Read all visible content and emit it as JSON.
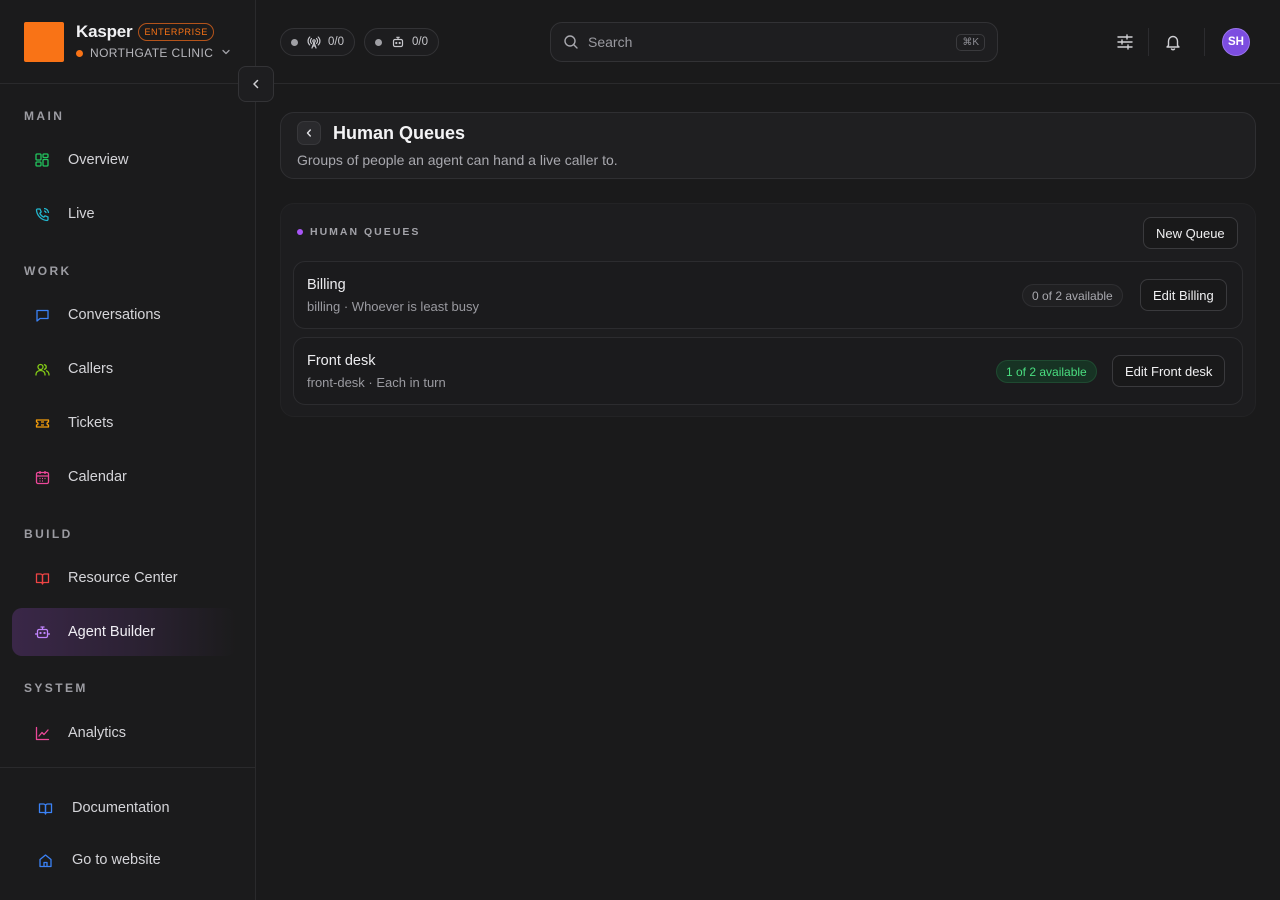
{
  "brand": {
    "name": "Kasper",
    "tier": "ENTERPRISE",
    "org": "NORTHGATE CLINIC"
  },
  "status_pills": [
    {
      "icon": "antenna-icon",
      "value": "0/0"
    },
    {
      "icon": "bot-icon",
      "value": "0/0"
    }
  ],
  "search": {
    "placeholder": "Search",
    "shortcut": "⌘K"
  },
  "user": {
    "initials": "SH"
  },
  "sidebar": {
    "sections": {
      "main": "MAIN",
      "work": "WORK",
      "build": "BUILD",
      "system": "SYSTEM"
    },
    "items": [
      {
        "label": "Overview",
        "icon": "grid-icon"
      },
      {
        "label": "Live",
        "icon": "phone-icon"
      },
      {
        "label": "Conversations",
        "icon": "chat-icon"
      },
      {
        "label": "Callers",
        "icon": "users-icon"
      },
      {
        "label": "Tickets",
        "icon": "ticket-icon"
      },
      {
        "label": "Calendar",
        "icon": "calendar-icon"
      },
      {
        "label": "Resource Center",
        "icon": "book-icon"
      },
      {
        "label": "Agent Builder",
        "icon": "bot-icon",
        "active": true
      },
      {
        "label": "Analytics",
        "icon": "chart-icon"
      }
    ],
    "footer": [
      {
        "label": "Documentation",
        "icon": "book-open-icon"
      },
      {
        "label": "Go to website",
        "icon": "home-icon"
      }
    ]
  },
  "page": {
    "title": "Human Queues",
    "subtitle": "Groups of people an agent can hand a live caller to."
  },
  "queues_panel": {
    "label": "HUMAN QUEUES",
    "new_button": "New Queue",
    "queues": [
      {
        "name": "Billing",
        "meta": "billing · Whoever is least busy",
        "availability": "0 of 2 available",
        "available": 0,
        "total": 2,
        "edit_label": "Edit Billing"
      },
      {
        "name": "Front desk",
        "meta": "front-desk · Each in turn",
        "availability": "1 of 2 available",
        "available": 1,
        "total": 2,
        "edit_label": "Edit Front desk"
      }
    ]
  },
  "colors": {
    "accent_orange": "#f97316",
    "accent_purple": "#a855f7",
    "available_green": "#4ade80",
    "background": "#1a1a1b"
  }
}
